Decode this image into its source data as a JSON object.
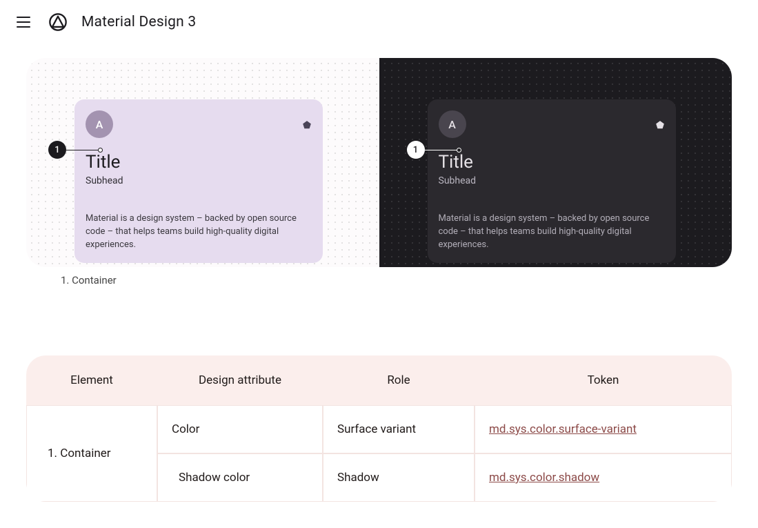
{
  "header": {
    "brand": "Material Design 3"
  },
  "card": {
    "avatar_initial": "A",
    "title": "Title",
    "subhead": "Subhead",
    "body": "Material is a design system – backed by open source code – that helps teams build high-quality digital experiences."
  },
  "annotation": {
    "badge_number": "1"
  },
  "caption": "1. Container",
  "table": {
    "headers": {
      "element": "Element",
      "attribute": "Design attribute",
      "role": "Role",
      "token": "Token"
    },
    "rows": [
      {
        "element": "1. Container",
        "attribute": "Color",
        "role": "Surface variant",
        "token": "md.sys.color.surface-variant"
      },
      {
        "element": "",
        "attribute": "Shadow color",
        "role": "Shadow",
        "token": "md.sys.color.shadow"
      }
    ]
  }
}
